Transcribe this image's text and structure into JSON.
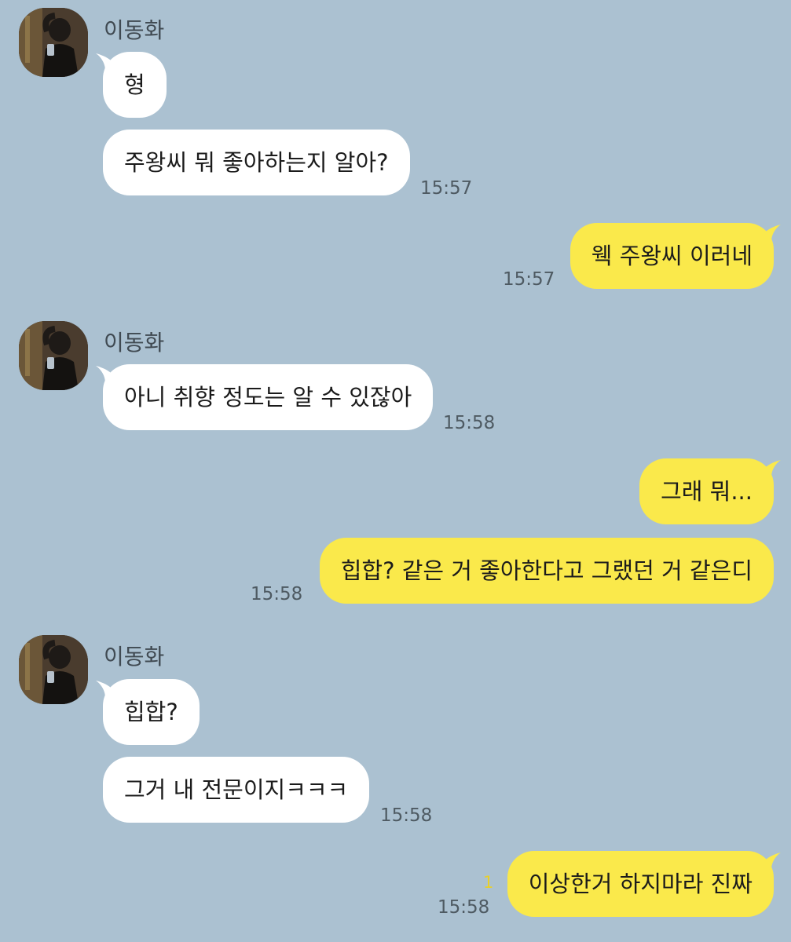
{
  "sender_name": "이동화",
  "colors": {
    "background": "#abc1d1",
    "incoming_bubble": "#ffffff",
    "outgoing_bubble": "#fae94b",
    "unread_count": "#e8cf2a"
  },
  "messages": [
    {
      "side": "in",
      "text": "형"
    },
    {
      "side": "in",
      "text": "주왕씨 뭐 좋아하는지 알아?",
      "time": "15:57"
    },
    {
      "side": "out",
      "text": "웩 주왕씨 이러네",
      "time": "15:57"
    },
    {
      "side": "in",
      "text": "아니 취향 정도는 알 수 있잖아",
      "time": "15:58"
    },
    {
      "side": "out",
      "text": "그래 뭐..."
    },
    {
      "side": "out",
      "text": "힙합? 같은 거 좋아한다고 그랬던 거 같은디",
      "time": "15:58"
    },
    {
      "side": "in",
      "text": "힙합?"
    },
    {
      "side": "in",
      "text": "그거 내 전문이지ㅋㅋㅋ",
      "time": "15:58"
    },
    {
      "side": "out",
      "text": "이상한거 하지마라 진짜",
      "time": "15:58",
      "unread": "1"
    }
  ]
}
